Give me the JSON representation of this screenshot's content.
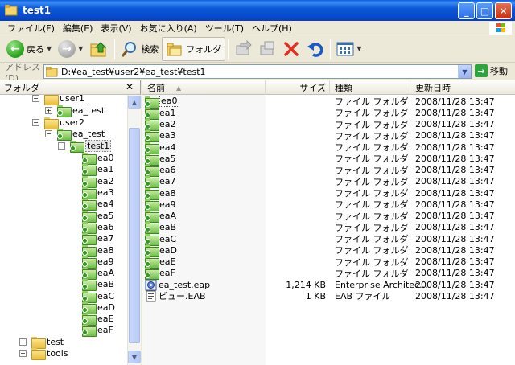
{
  "window": {
    "title": "test1",
    "buttons": {
      "minimize": "_",
      "maximize": "□",
      "close": "✕"
    }
  },
  "menu": {
    "items": [
      "ファイル(F)",
      "編集(E)",
      "表示(V)",
      "お気に入り(A)",
      "ツール(T)",
      "ヘルプ(H)"
    ]
  },
  "toolbar": {
    "back_label": "戻る",
    "search_label": "検索",
    "folders_label": "フォルダ"
  },
  "address": {
    "label": "アドレス(D)",
    "value": "D:¥ea_test¥user2¥ea_test¥test1",
    "go_label": "移動"
  },
  "folder_pane": {
    "title": "フォルダ",
    "close": "✕",
    "tree": [
      {
        "label": "user1",
        "expander": "−",
        "icon": "folder-yellow"
      },
      {
        "label": "ea_test",
        "expander": "+",
        "icon": "folder-green"
      },
      {
        "label": "user2",
        "expander": "−",
        "icon": "folder-yellow"
      },
      {
        "label": "ea_test",
        "expander": "−",
        "icon": "folder-green"
      },
      {
        "label": "test1",
        "expander": "−",
        "icon": "folder-green",
        "selected": true
      },
      {
        "label": "ea0",
        "icon": "folder-green"
      },
      {
        "label": "ea1",
        "icon": "folder-green"
      },
      {
        "label": "ea2",
        "icon": "folder-green"
      },
      {
        "label": "ea3",
        "icon": "folder-green"
      },
      {
        "label": "ea4",
        "icon": "folder-green"
      },
      {
        "label": "ea5",
        "icon": "folder-green"
      },
      {
        "label": "ea6",
        "icon": "folder-green"
      },
      {
        "label": "ea7",
        "icon": "folder-green"
      },
      {
        "label": "ea8",
        "icon": "folder-green"
      },
      {
        "label": "ea9",
        "icon": "folder-green"
      },
      {
        "label": "eaA",
        "icon": "folder-green"
      },
      {
        "label": "eaB",
        "icon": "folder-green"
      },
      {
        "label": "eaC",
        "icon": "folder-green"
      },
      {
        "label": "eaD",
        "icon": "folder-green"
      },
      {
        "label": "eaE",
        "icon": "folder-green"
      },
      {
        "label": "eaF",
        "icon": "folder-green"
      },
      {
        "label": "test",
        "expander": "+",
        "icon": "folder-yellow"
      },
      {
        "label": "tools",
        "expander": "+",
        "icon": "folder-yellow"
      }
    ]
  },
  "file_list": {
    "columns": {
      "name": "名前",
      "size": "サイズ",
      "type": "種類",
      "date": "更新日時"
    },
    "rows": [
      {
        "name": "ea0",
        "size": "",
        "type": "ファイル フォルダ",
        "date": "2008/11/28 13:47",
        "icon": "folder-green"
      },
      {
        "name": "ea1",
        "size": "",
        "type": "ファイル フォルダ",
        "date": "2008/11/28 13:47",
        "icon": "folder-green"
      },
      {
        "name": "ea2",
        "size": "",
        "type": "ファイル フォルダ",
        "date": "2008/11/28 13:47",
        "icon": "folder-green"
      },
      {
        "name": "ea3",
        "size": "",
        "type": "ファイル フォルダ",
        "date": "2008/11/28 13:47",
        "icon": "folder-green"
      },
      {
        "name": "ea4",
        "size": "",
        "type": "ファイル フォルダ",
        "date": "2008/11/28 13:47",
        "icon": "folder-green"
      },
      {
        "name": "ea5",
        "size": "",
        "type": "ファイル フォルダ",
        "date": "2008/11/28 13:47",
        "icon": "folder-green"
      },
      {
        "name": "ea6",
        "size": "",
        "type": "ファイル フォルダ",
        "date": "2008/11/28 13:47",
        "icon": "folder-green"
      },
      {
        "name": "ea7",
        "size": "",
        "type": "ファイル フォルダ",
        "date": "2008/11/28 13:47",
        "icon": "folder-green"
      },
      {
        "name": "ea8",
        "size": "",
        "type": "ファイル フォルダ",
        "date": "2008/11/28 13:47",
        "icon": "folder-green"
      },
      {
        "name": "ea9",
        "size": "",
        "type": "ファイル フォルダ",
        "date": "2008/11/28 13:47",
        "icon": "folder-green"
      },
      {
        "name": "eaA",
        "size": "",
        "type": "ファイル フォルダ",
        "date": "2008/11/28 13:47",
        "icon": "folder-green"
      },
      {
        "name": "eaB",
        "size": "",
        "type": "ファイル フォルダ",
        "date": "2008/11/28 13:47",
        "icon": "folder-green"
      },
      {
        "name": "eaC",
        "size": "",
        "type": "ファイル フォルダ",
        "date": "2008/11/28 13:47",
        "icon": "folder-green"
      },
      {
        "name": "eaD",
        "size": "",
        "type": "ファイル フォルダ",
        "date": "2008/11/28 13:47",
        "icon": "folder-green"
      },
      {
        "name": "eaE",
        "size": "",
        "type": "ファイル フォルダ",
        "date": "2008/11/28 13:47",
        "icon": "folder-green"
      },
      {
        "name": "eaF",
        "size": "",
        "type": "ファイル フォルダ",
        "date": "2008/11/28 13:47",
        "icon": "folder-green"
      },
      {
        "name": "ea_test.eap",
        "size": "1,214 KB",
        "type": "Enterprise Architec...",
        "date": "2008/11/28 13:47",
        "icon": "eap-file"
      },
      {
        "name": "ビュー.EAB",
        "size": "1 KB",
        "type": "EAB ファイル",
        "date": "2008/11/28 13:47",
        "icon": "eab-file"
      }
    ]
  }
}
